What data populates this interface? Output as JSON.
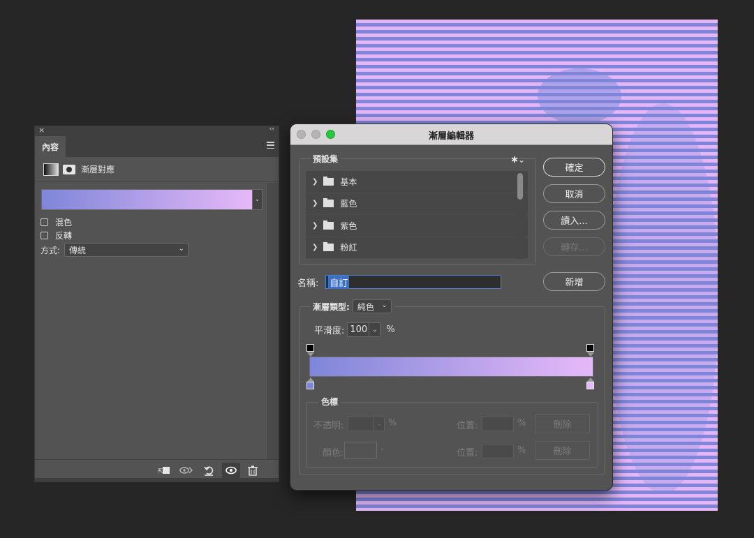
{
  "properties_panel": {
    "close_glyph": "×",
    "collapse_glyph": "‹‹",
    "tab_label": "內容",
    "layer_label": "漸層對應",
    "dither_label": "混色",
    "reverse_label": "反轉",
    "method_label": "方式:",
    "method_value": "傳統",
    "colors": {
      "gradient_start": "#7f86d9",
      "gradient_end": "#e6b9f8"
    }
  },
  "gradient_editor": {
    "title": "漸層編輯器",
    "presets_legend": "預設集",
    "presets": [
      {
        "label": "基本"
      },
      {
        "label": "藍色"
      },
      {
        "label": "紫色"
      },
      {
        "label": "粉紅"
      }
    ],
    "buttons": {
      "ok": "確定",
      "cancel": "取消",
      "load": "讀入...",
      "save": "轉存...",
      "new": "新增"
    },
    "name_label": "名稱:",
    "name_value": "自訂",
    "gradient_type_label": "漸層類型:",
    "gradient_type_value": "純色",
    "smoothness_label": "平滑度:",
    "smoothness_value": "100",
    "percent": "%",
    "stops_legend": "色標",
    "opacity_label": "不透明:",
    "color_label": "顏色:",
    "location_label": "位置:",
    "delete_label": "刪除",
    "colors": {
      "stop_left": "#7f86d9",
      "stop_right": "#e6b9f8",
      "opacity_stop": "#000000"
    }
  },
  "canvas": {
    "colors": {
      "stripe_light": "#e6b5f6",
      "stripe_dark": "#7f86d9"
    }
  }
}
